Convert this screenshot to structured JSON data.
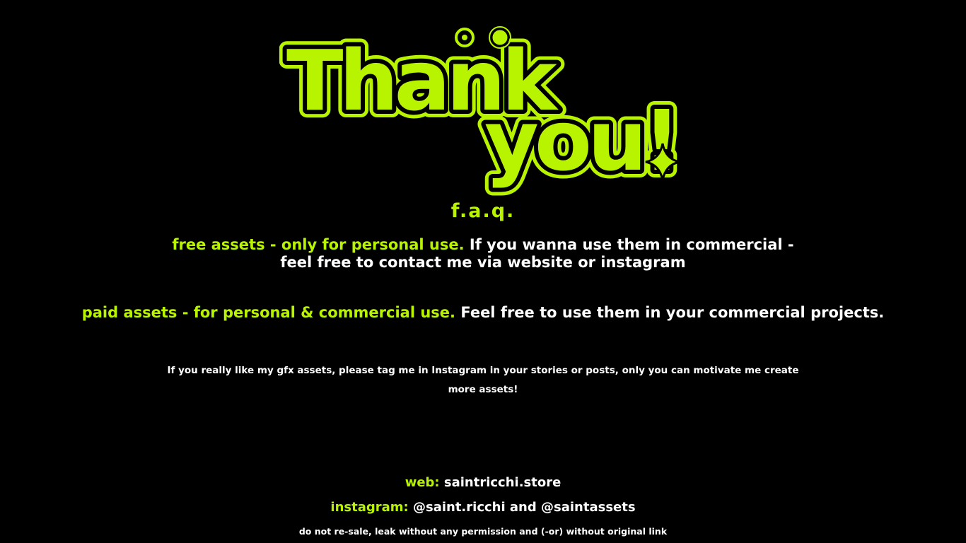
{
  "logo": {
    "line1": "Thank",
    "line2": "you!",
    "accent_color": "#b8f400",
    "icon": "sparkle-icon"
  },
  "faq": {
    "title": "f.a.q.",
    "free_highlight": "free assets - only for personal use.",
    "free_text_1": " If you wanna use them in commercial -",
    "free_text_2": "feel free to contact me via website or instagram",
    "paid_highlight": "paid assets - for personal & commercial use.",
    "paid_text": " Feel free to use them in your commercial projects."
  },
  "note": {
    "line1": "If you really like my gfx assets, please tag me in Instagram in your stories or posts, only you can motivate me create",
    "line2": "more assets!"
  },
  "contacts": {
    "web_label": "web:",
    "web_value": " saintricchi.store",
    "instagram_label": "instagram:",
    "instagram_value": " @saint.ricchi and @saintassets"
  },
  "footer": {
    "warning": "do not re-sale, leak without any permission and (-or) without original link"
  }
}
